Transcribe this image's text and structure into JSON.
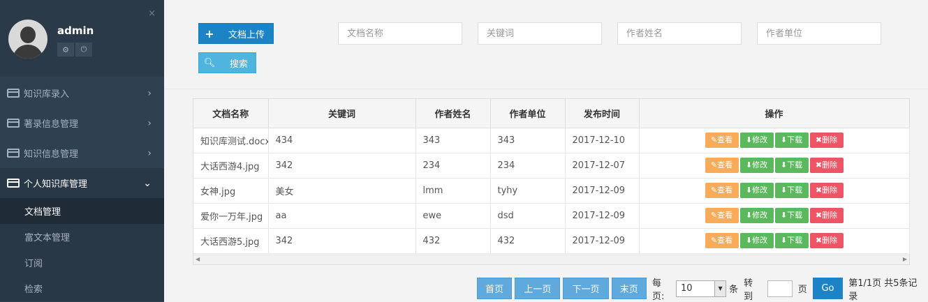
{
  "sidebar": {
    "username": "admin",
    "profile_tools": [
      "⚙",
      "⏻"
    ],
    "menu": [
      {
        "label": "知识库录入"
      },
      {
        "label": "著录信息管理"
      },
      {
        "label": "知识信息管理"
      },
      {
        "label": "个人知识库管理"
      }
    ],
    "submenu": [
      {
        "label": "文档管理"
      },
      {
        "label": "富文本管理"
      },
      {
        "label": "订阅"
      },
      {
        "label": "检索"
      }
    ]
  },
  "toolbar": {
    "upload_label": "文档上传",
    "search_label": "搜索",
    "filters": {
      "doc_name": "文档名称",
      "keyword": "关键词",
      "author": "作者姓名",
      "org": "作者单位"
    }
  },
  "table": {
    "headers": [
      "文档名称",
      "关键词",
      "作者姓名",
      "作者单位",
      "发布时间",
      "操作"
    ],
    "rows": [
      [
        "知识库测试.docx",
        "434",
        "343",
        "343",
        "2017-12-10"
      ],
      [
        "大话西游4.jpg",
        "342",
        "234",
        "234",
        "2017-12-07"
      ],
      [
        "女神.jpg",
        "美女",
        "lmm",
        "tyhy",
        "2017-12-09"
      ],
      [
        "爱你一万年.jpg",
        "aa",
        "ewe",
        "dsd",
        "2017-12-09"
      ],
      [
        "大话西游5.jpg",
        "342",
        "432",
        "432",
        "2017-12-09"
      ]
    ],
    "ops": {
      "view": "✎查看",
      "edit": "⬇修改",
      "download": "⬇下载",
      "delete": "✖删除"
    }
  },
  "pager": {
    "first": "首页",
    "prev": "上一页",
    "next": "下一页",
    "last": "末页",
    "per_page_label": "每页:",
    "per_page_value": "10",
    "unit_label": "条",
    "goto_label": "转到",
    "page_label": "页",
    "go": "Go",
    "summary": "第1/1页 共5条记录"
  }
}
